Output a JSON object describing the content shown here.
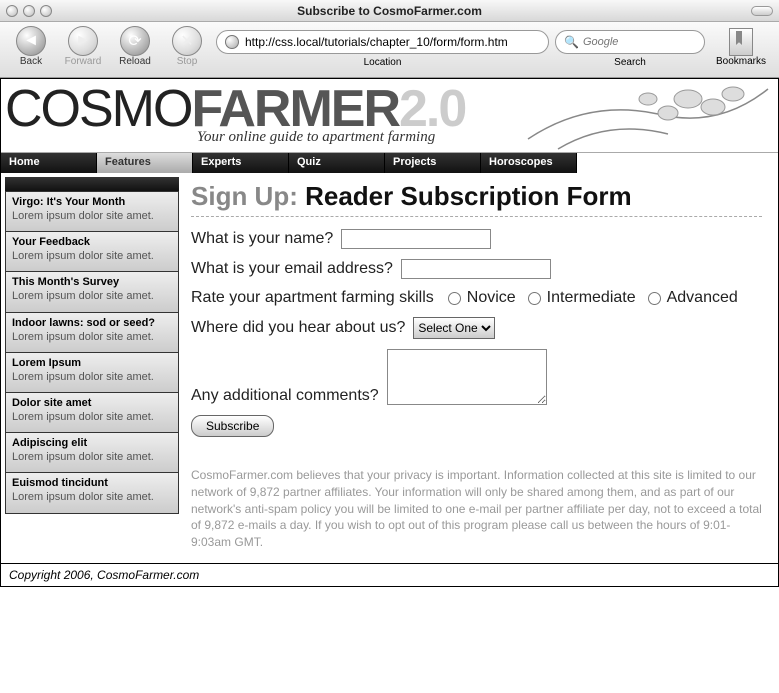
{
  "chrome": {
    "title": "Subscribe to CosmoFarmer.com",
    "back": "Back",
    "forward": "Forward",
    "reload": "Reload",
    "stop": "Stop",
    "url": "http://css.local/tutorials/chapter_10/form/form.htm",
    "location_label": "Location",
    "search_placeholder": "Google",
    "search_label": "Search",
    "bookmarks": "Bookmarks"
  },
  "brand": {
    "part1": "COSMO",
    "part2": "FARMER",
    "ver": "2.0",
    "tagline": "Your online guide to apartment farming"
  },
  "nav": [
    {
      "label": "Home",
      "active": false
    },
    {
      "label": "Features",
      "active": true
    },
    {
      "label": "Experts",
      "active": false
    },
    {
      "label": "Quiz",
      "active": false
    },
    {
      "label": "Projects",
      "active": false
    },
    {
      "label": "Horoscopes",
      "active": false
    }
  ],
  "sidebar": [
    {
      "title": "Virgo: It's Your Month",
      "body": "Lorem ipsum dolor site amet."
    },
    {
      "title": "Your Feedback",
      "body": "Lorem ipsum dolor site amet."
    },
    {
      "title": "This Month's Survey",
      "body": "Lorem ipsum dolor site amet."
    },
    {
      "title": "Indoor lawns: sod or seed?",
      "body": "Lorem ipsum dolor site amet."
    },
    {
      "title": "Lorem Ipsum",
      "body": "Lorem ipsum dolor site amet."
    },
    {
      "title": "Dolor site amet",
      "body": "Lorem ipsum dolor site amet."
    },
    {
      "title": "Adipiscing elit",
      "body": "Lorem ipsum dolor site amet."
    },
    {
      "title": "Euismod tincidunt",
      "body": "Lorem ipsum dolor site amet."
    }
  ],
  "form": {
    "heading_prefix": "Sign Up: ",
    "heading_main": "Reader Subscription Form",
    "name_label": "What is your name?",
    "email_label": "What is your email address?",
    "rate_label": "Rate your apartment farming skills",
    "rate_opts": {
      "novice": "Novice",
      "intermediate": "Intermediate",
      "advanced": "Advanced"
    },
    "hear_label": "Where did you hear about us?",
    "hear_selected": "Select One",
    "comments_label": "Any additional comments?",
    "submit": "Subscribe"
  },
  "privacy": "CosmoFarmer.com believes that your privacy is important. Information collected at this site is limited to our network of 9,872 partner affiliates. Your information will only be shared among them, and as part of our network's anti-spam policy you will be limited to one e-mail per partner affiliate per day, not to exceed a total of 9,872 e-mails a day. If you wish to opt out of this program please call us between the hours of 9:01-9:03am GMT.",
  "footer": "Copyright 2006, CosmoFarmer.com"
}
